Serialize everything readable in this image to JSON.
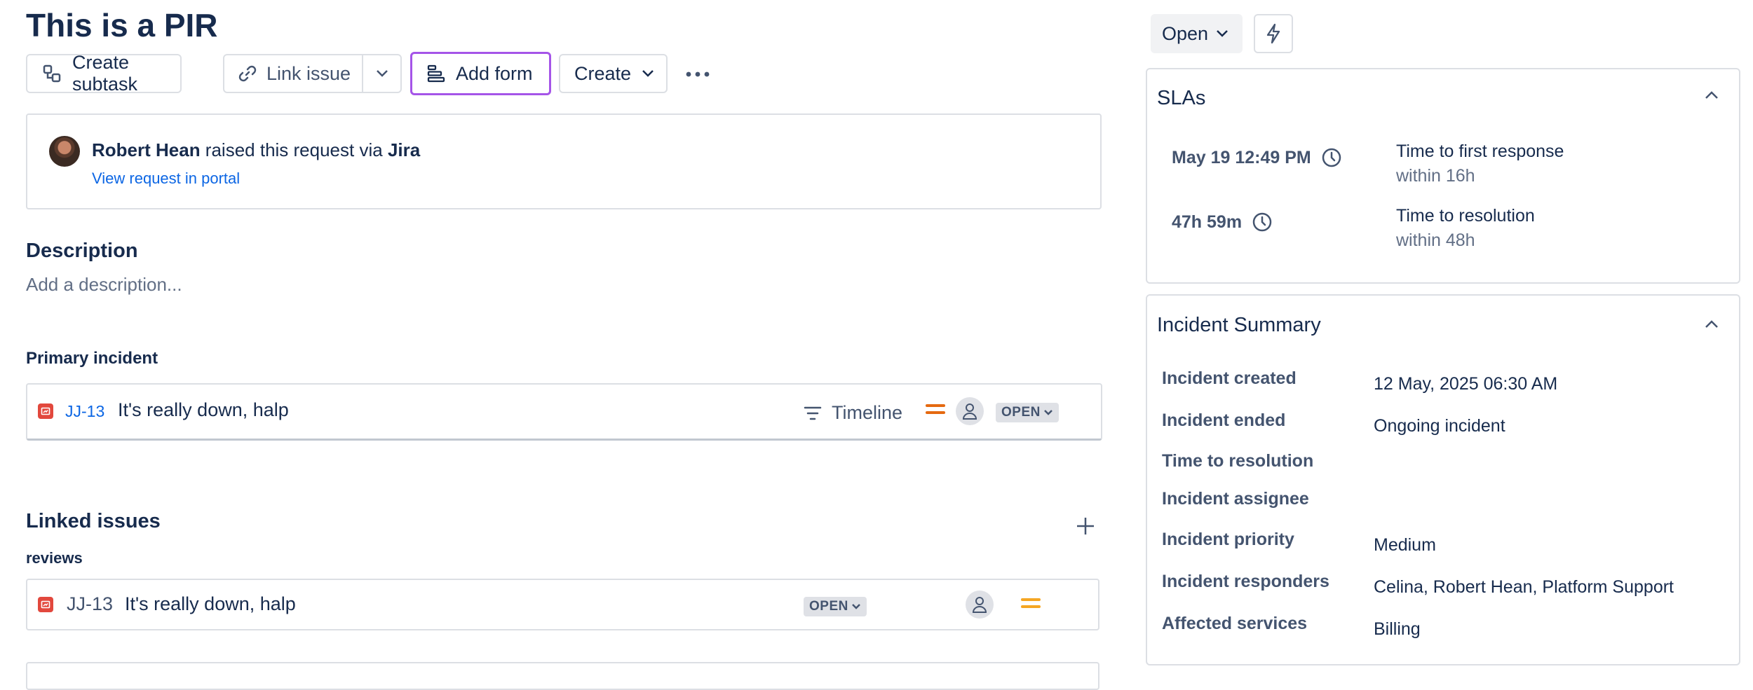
{
  "issue": {
    "title": "This is a PIR"
  },
  "toolbar": {
    "create_subtask": "Create subtask",
    "link_issue": "Link issue",
    "add_form": "Add form",
    "create": "Create"
  },
  "reporter": {
    "name": "Robert Hean",
    "raised_text": " raised this request via ",
    "channel": "Jira",
    "portal_link": "View request in portal"
  },
  "description": {
    "heading": "Description",
    "placeholder": "Add a description..."
  },
  "primary_incident": {
    "heading": "Primary incident",
    "key": "JJ-13",
    "summary": "It's really down, halp",
    "timeline_label": "Timeline",
    "status": "OPEN",
    "priority_color": "#e56910"
  },
  "linked_issues": {
    "heading": "Linked issues",
    "relation": "reviews",
    "items": [
      {
        "key": "JJ-13",
        "summary": "It's really down, halp",
        "status": "OPEN",
        "priority_color": "#f5a623"
      }
    ]
  },
  "status_button": {
    "label": "Open"
  },
  "slas": {
    "heading": "SLAs",
    "items": [
      {
        "time": "May 19 12:49 PM",
        "goal": "Time to first response",
        "limit": "within 16h"
      },
      {
        "time": "47h 59m",
        "goal": "Time to resolution",
        "limit": "within 48h"
      }
    ]
  },
  "incident_summary": {
    "heading": "Incident Summary",
    "fields": [
      {
        "label": "Incident created",
        "value": "12 May, 2025 06:30 AM"
      },
      {
        "label": "Incident ended",
        "value": "Ongoing incident"
      },
      {
        "label": "Time to resolution",
        "value": ""
      },
      {
        "label": "Incident assignee",
        "value": ""
      },
      {
        "label": "Incident priority",
        "value": "Medium"
      },
      {
        "label": "Incident responders",
        "value": "Celina, Robert Hean, Platform Support"
      },
      {
        "label": "Affected services",
        "value": "Billing"
      }
    ]
  },
  "colors": {
    "accent_link": "#0c66e4",
    "add_form_border": "#a554e8",
    "issue_icon": "#e2483d"
  }
}
